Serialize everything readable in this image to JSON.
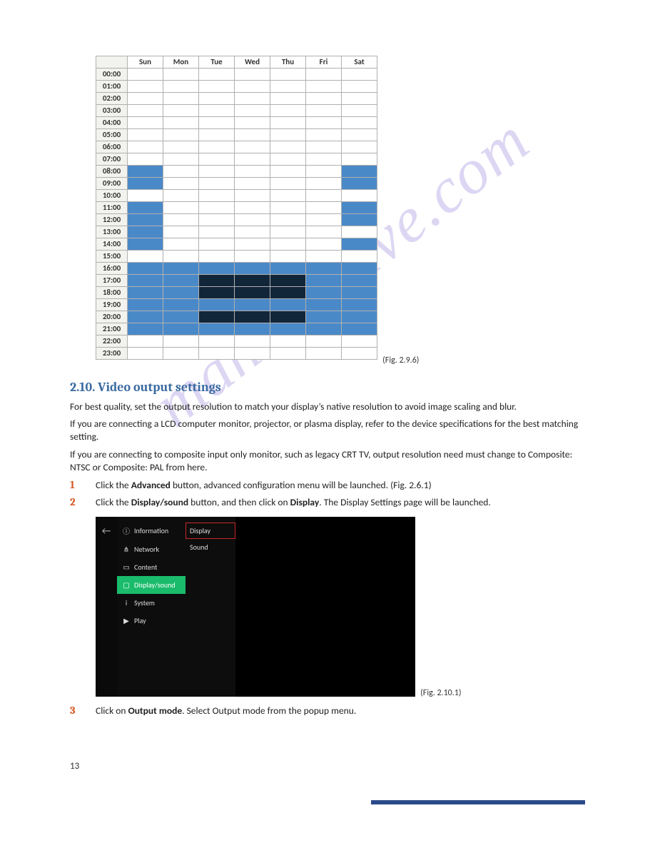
{
  "watermark": "manualslive.com",
  "schedule": {
    "days": [
      "Sun",
      "Mon",
      "Tue",
      "Wed",
      "Thu",
      "Fri",
      "Sat"
    ],
    "hours": [
      "00:00",
      "01:00",
      "02:00",
      "03:00",
      "04:00",
      "05:00",
      "06:00",
      "07:00",
      "08:00",
      "09:00",
      "10:00",
      "11:00",
      "12:00",
      "13:00",
      "14:00",
      "15:00",
      "16:00",
      "17:00",
      "18:00",
      "19:00",
      "20:00",
      "21:00",
      "22:00",
      "23:00"
    ],
    "cells": {
      "08:00": [
        "b",
        "",
        "",
        "",
        "",
        "",
        "b"
      ],
      "09:00": [
        "b",
        "",
        "",
        "",
        "",
        "",
        "b"
      ],
      "11:00": [
        "b",
        "",
        "",
        "",
        "",
        "",
        "b"
      ],
      "12:00": [
        "b",
        "",
        "",
        "",
        "",
        "",
        "b"
      ],
      "13:00": [
        "b",
        "",
        "",
        "",
        "",
        "",
        ""
      ],
      "14:00": [
        "b",
        "",
        "",
        "",
        "",
        "",
        "b"
      ],
      "16:00": [
        "b",
        "b",
        "b",
        "b",
        "b",
        "b",
        "b"
      ],
      "17:00": [
        "b",
        "b",
        "d",
        "d",
        "d",
        "b",
        "b"
      ],
      "18:00": [
        "b",
        "b",
        "d",
        "d",
        "d",
        "b",
        "b"
      ],
      "19:00": [
        "b",
        "b",
        "b",
        "b",
        "b",
        "b",
        "b"
      ],
      "20:00": [
        "b",
        "b",
        "d",
        "d",
        "d",
        "b",
        "b"
      ],
      "21:00": [
        "b",
        "b",
        "b",
        "b",
        "b",
        "b",
        "b"
      ]
    },
    "caption": "(Fig. 2.9.6)"
  },
  "heading": "2.10.   Video output settings",
  "para1": "For best quality, set the output resolution to match your display’s native resolution to avoid image scaling and blur.",
  "para2": "If you are connecting a LCD computer monitor, projector, or plasma display, refer to the device specifications for the best matching setting.",
  "para3": "If you are connecting to composite input only monitor, such as legacy CRT TV, output resolution need must change to Composite: NTSC or Composite: PAL from here.",
  "steps": {
    "s1": {
      "num": "1",
      "pre": "Click the ",
      "bold": "Advanced",
      "post": " button, advanced configuration menu will be launched. (Fig. 2.6.1)"
    },
    "s2": {
      "num": "2",
      "pre": "Click the ",
      "bold1": "Display/sound",
      "mid": " button, and then click on ",
      "bold2": "Display",
      "post": ". The Display Settings page will be launched."
    },
    "s3": {
      "num": "3",
      "pre": "Click on ",
      "bold": "Output mode",
      "post": ". Select Output mode from the popup menu."
    }
  },
  "settings": {
    "back": "←",
    "menu": {
      "information": "Information",
      "network": "Network",
      "content": "Content",
      "display_sound": "Display/sound",
      "system": "System",
      "play": "Play"
    },
    "sub": {
      "display": "Display",
      "sound": "Sound"
    },
    "caption": "(Fig. 2.10.1)"
  },
  "page_num": "13"
}
